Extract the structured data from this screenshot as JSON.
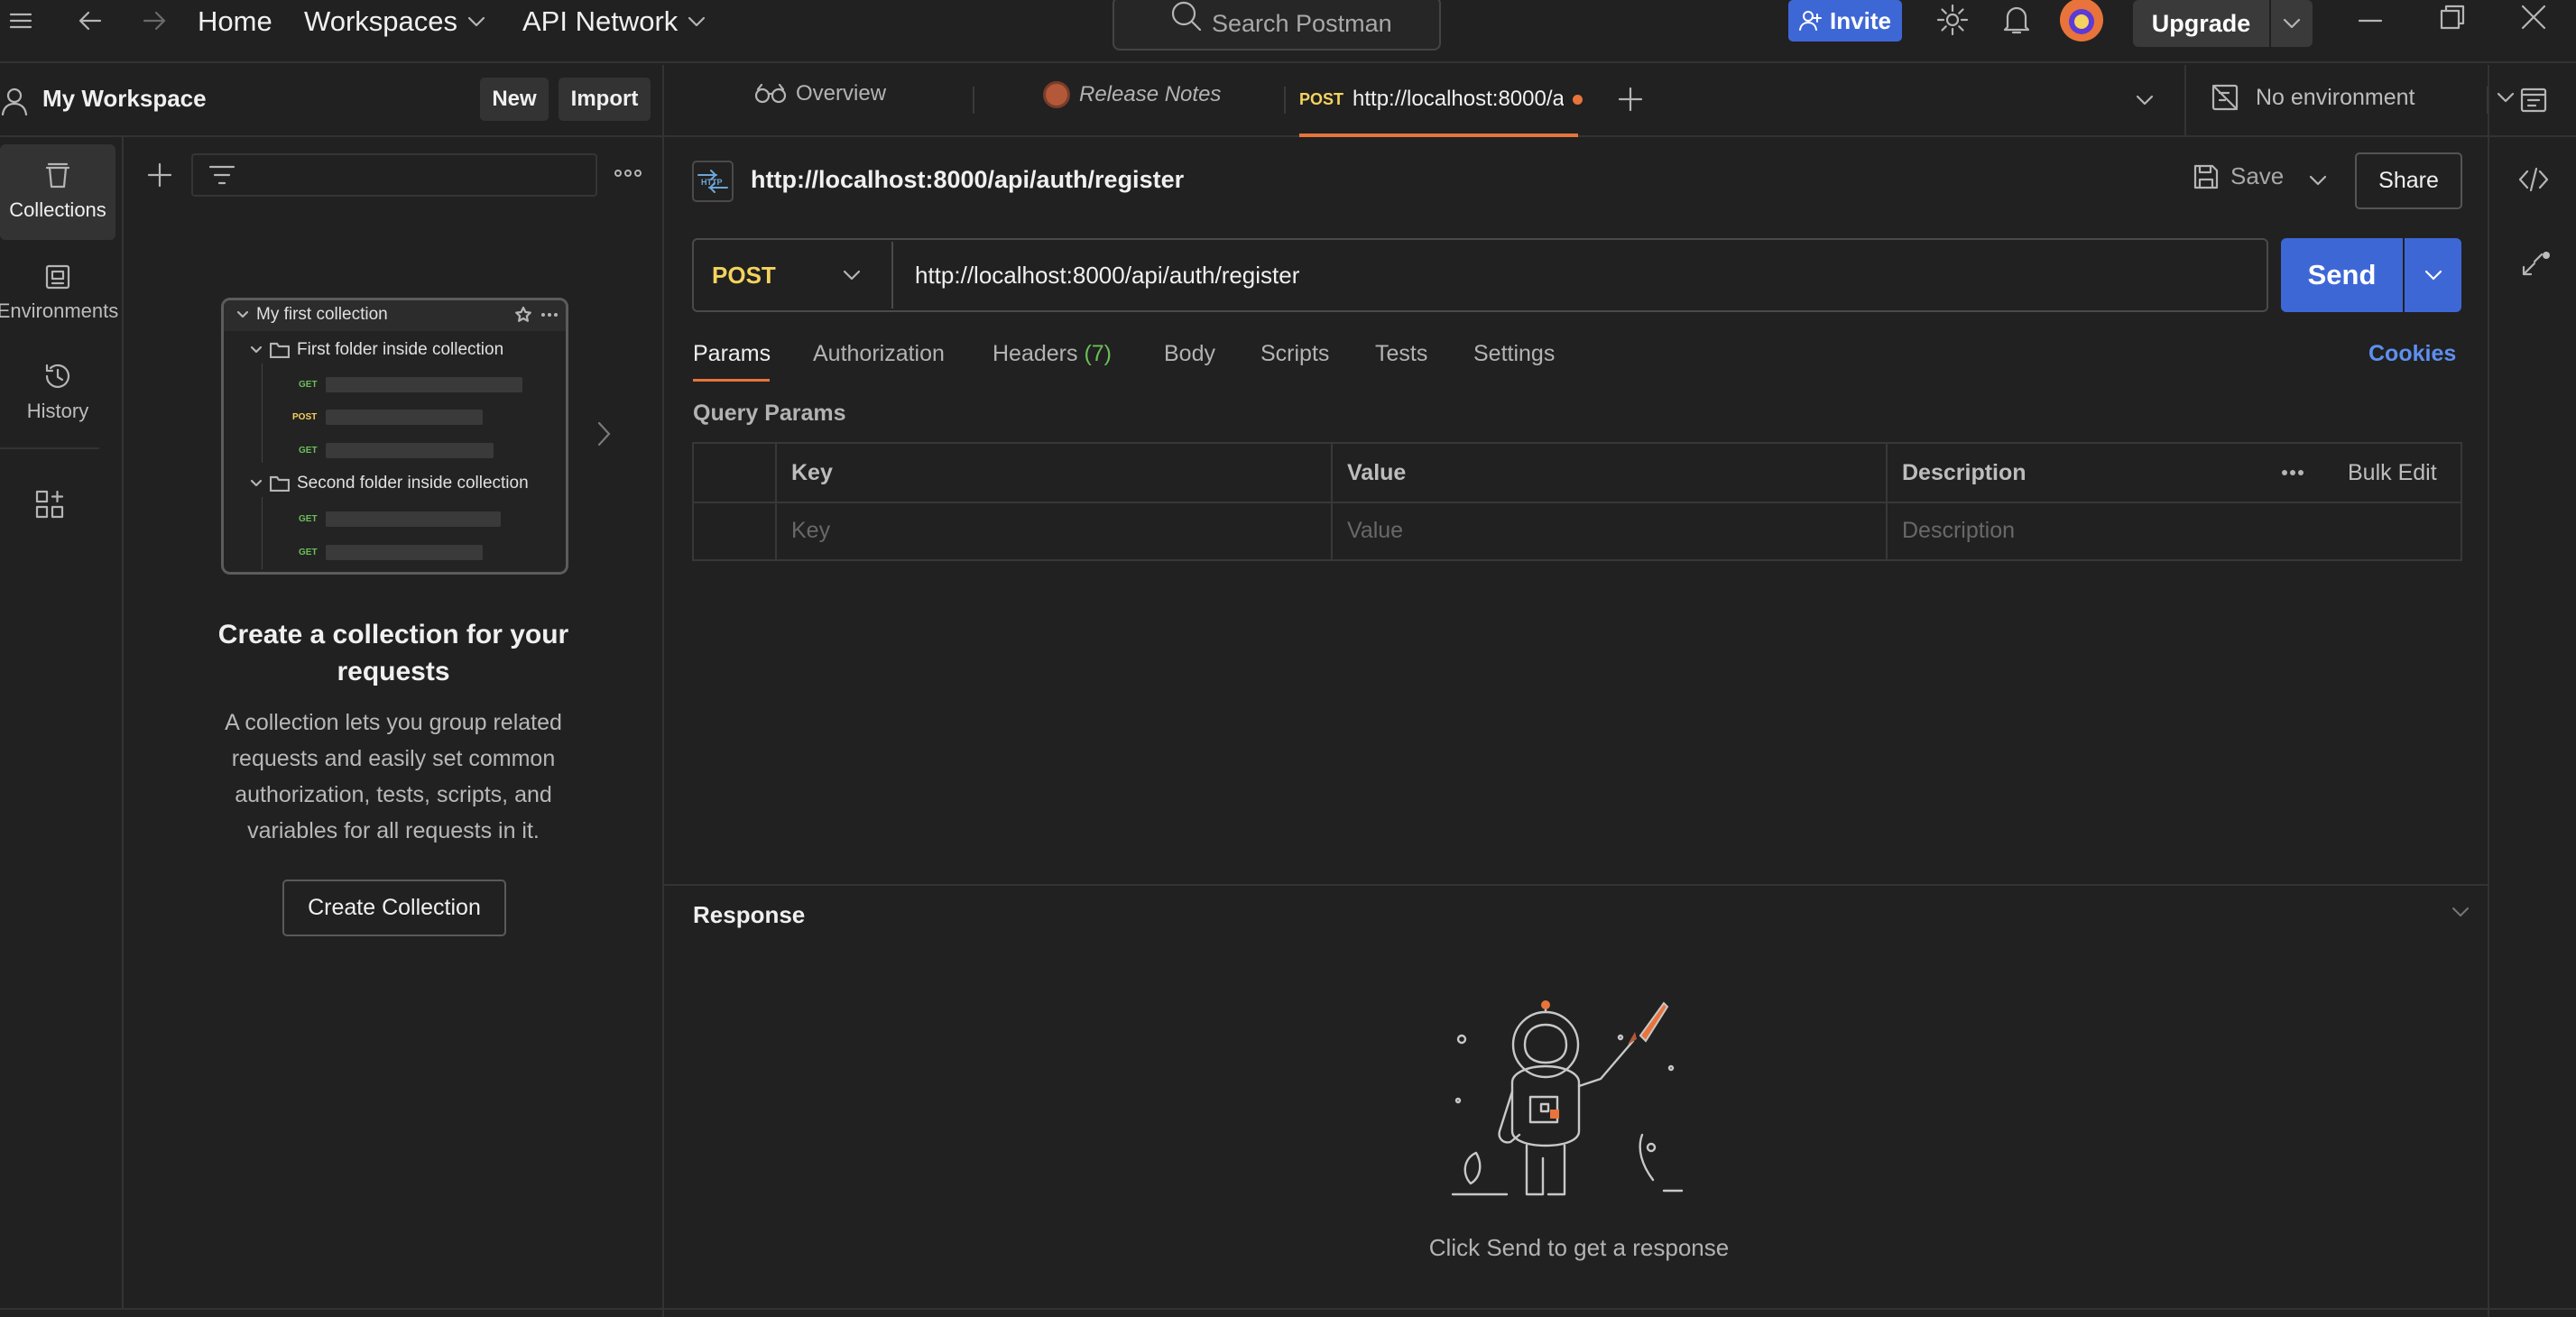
{
  "topbar": {
    "home": "Home",
    "workspaces": "Workspaces",
    "api_network": "API Network",
    "search_placeholder": "Search Postman",
    "invite": "Invite",
    "upgrade": "Upgrade"
  },
  "workspace": {
    "title": "My Workspace",
    "new_label": "New",
    "import_label": "Import"
  },
  "rail": {
    "collections": "Collections",
    "environments": "Environments",
    "history": "History"
  },
  "preview": {
    "collection": "My first collection",
    "folder1": "First folder inside collection",
    "folder2": "Second folder inside collection",
    "methods": [
      "GET",
      "POST",
      "GET",
      "GET",
      "GET"
    ]
  },
  "empty_state": {
    "heading": "Create a collection for your requests",
    "description": "A collection lets you group related requests and easily set common authorization, tests, scripts, and variables for all requests in it.",
    "button": "Create Collection"
  },
  "tabs": {
    "overview": "Overview",
    "release_notes": "Release Notes",
    "active_method": "POST",
    "active_url": "http://localhost:8000/a",
    "environment": "No environment"
  },
  "request": {
    "title": "http://localhost:8000/api/auth/register",
    "save": "Save",
    "share": "Share",
    "method": "POST",
    "url": "http://localhost:8000/api/auth/register",
    "send": "Send"
  },
  "subtabs": {
    "params": "Params",
    "authorization": "Authorization",
    "headers": "Headers",
    "headers_count": "(7)",
    "body": "Body",
    "scripts": "Scripts",
    "tests": "Tests",
    "settings": "Settings",
    "cookies": "Cookies"
  },
  "query_params": {
    "label": "Query Params",
    "columns": [
      "Key",
      "Value",
      "Description"
    ],
    "bulk_edit": "Bulk Edit",
    "placeholders": [
      "Key",
      "Value",
      "Description"
    ]
  },
  "response": {
    "label": "Response",
    "hint": "Click Send to get a response"
  },
  "colors": {
    "accent": "#e8743b",
    "primary": "#3e67d6",
    "post": "#f4d35e",
    "get": "#6bbf59",
    "link": "#5e8ff0"
  }
}
